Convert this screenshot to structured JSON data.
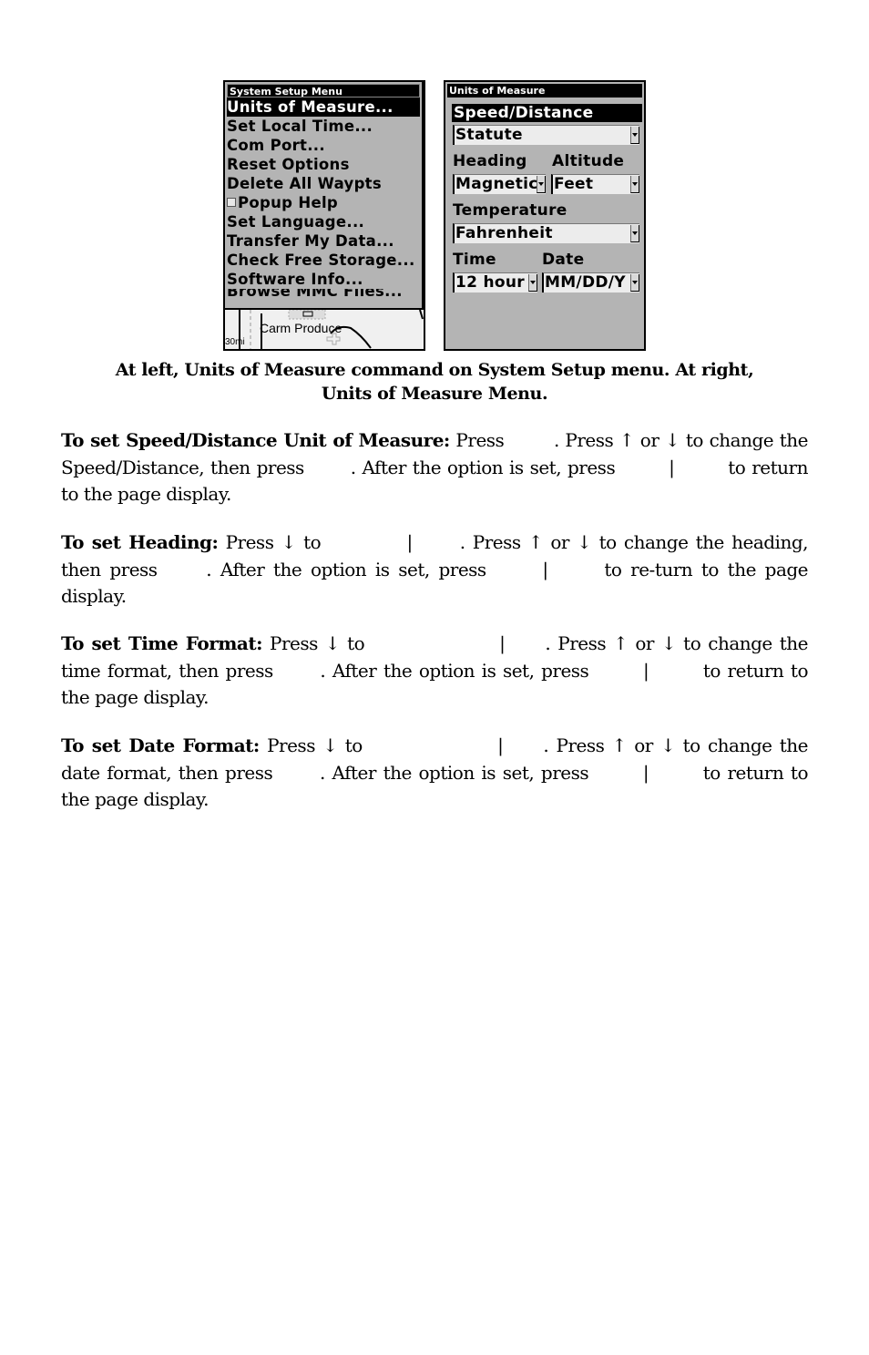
{
  "screenshots": {
    "left": {
      "menu_title": "System Setup Menu",
      "items": [
        {
          "label": "Units of Measure...",
          "selected": true
        },
        {
          "label": "Set Local Time..."
        },
        {
          "label": "Com Port..."
        },
        {
          "label": "Reset Options"
        },
        {
          "label": "Delete All Waypts"
        },
        {
          "label": "Popup Help",
          "checkbox": true,
          "checked": false
        },
        {
          "label": "Set Language..."
        },
        {
          "label": "Transfer My Data..."
        },
        {
          "label": "Check Free Storage..."
        },
        {
          "label": "Software Info..."
        },
        {
          "label": "Browse MMC Files...",
          "partially_hidden": true
        }
      ],
      "map": {
        "label": "Carm Produce",
        "scale": "30mi"
      }
    },
    "right": {
      "menu_title": "Units of Measure",
      "speed_distance": {
        "label": "Speed/Distance",
        "value": "Statute"
      },
      "heading": {
        "label": "Heading",
        "value": "Magnetic"
      },
      "altitude": {
        "label": "Altitude",
        "value": "Feet"
      },
      "temperature": {
        "label": "Temperature",
        "value": "Fahrenheit"
      },
      "time": {
        "label": "Time",
        "value": "12 hour"
      },
      "date": {
        "label": "Date",
        "value": "MM/DD/Y"
      }
    }
  },
  "caption": {
    "line1": "At left, Units of Measure command on System Setup menu. At right,",
    "line2": "Units of Measure Menu."
  },
  "paragraphs": {
    "speed": {
      "heading": "To set Speed/Distance Unit of Measure:",
      "t1": " Press ",
      "t2": ". Press ↑ or ↓ to change the Speed/Distance, then press ",
      "t3": ". After the option is set, press ",
      "sep": "|",
      "t4": " to return to the page display."
    },
    "heading": {
      "heading": "To set Heading:",
      "t1": " Press ↓ to ",
      "sep": "|",
      "t2": ". Press ↑ or ↓ to change the heading, then press ",
      "t3": ". After the option is set, press ",
      "t4": " to re-turn to the page display."
    },
    "time": {
      "heading": "To set Time Format:",
      "t1": " Press ↓ to ",
      "sep": "|",
      "t2": ". Press ↑ or ↓ to change the time format, then press ",
      "t3": ". After the option is set, press ",
      "t4": " to return to the page display."
    },
    "date": {
      "heading": "To set Date Format:",
      "t1": " Press ↓ to ",
      "sep": "|",
      "t2": ". Press ↑ or ↓ to change the date format, then press ",
      "t3": ". After the option is set, press ",
      "t4": " to return to the page display."
    }
  }
}
